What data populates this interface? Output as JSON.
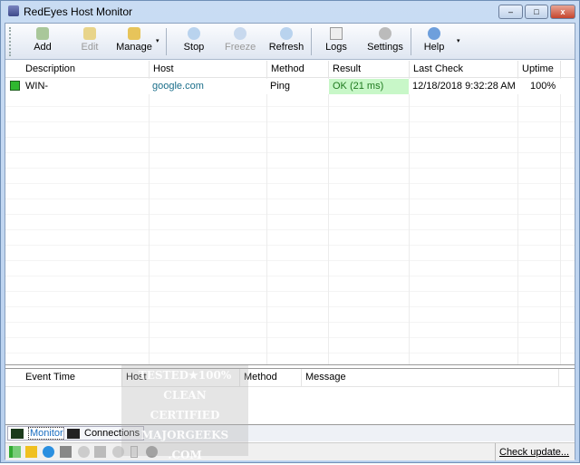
{
  "window": {
    "title": "RedEyes Host Monitor",
    "minimize": "–",
    "maximize": "□",
    "close": "x"
  },
  "toolbar": {
    "add": "Add",
    "edit": "Edit",
    "manage": "Manage",
    "stop": "Stop",
    "freeze": "Freeze",
    "refresh": "Refresh",
    "logs": "Logs",
    "settings": "Settings",
    "help": "Help",
    "dropdown": "▾"
  },
  "monitors": {
    "columns": [
      "Description",
      "Host",
      "Method",
      "Result",
      "Last Check",
      "Uptime"
    ],
    "rows": [
      {
        "description": "WIN-",
        "host": "google.com",
        "method": "Ping",
        "result": "OK (21 ms)",
        "last_check": "12/18/2018 9:32:28 AM",
        "uptime": "100%",
        "status_color": "#2fb82f"
      }
    ]
  },
  "events": {
    "columns": [
      "Event Time",
      "Host",
      "Method",
      "Message"
    ]
  },
  "tabs": [
    {
      "label": "Monitor",
      "active": true
    },
    {
      "label": "Connections",
      "active": false
    }
  ],
  "status": {
    "check_update": "Check update..."
  },
  "colors": {
    "result_ok_bg": "#c8f7c8",
    "host_link": "#1a6e8a",
    "accent": "#b8d0ee"
  },
  "watermark": "TESTED ★100% CLEAN CERTIFIED MAJORGEEKS .COM"
}
